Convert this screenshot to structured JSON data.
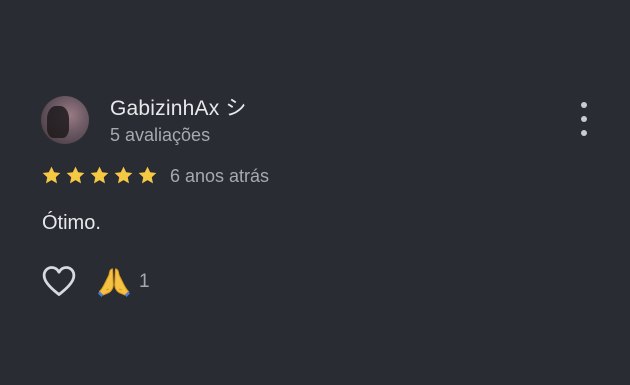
{
  "review": {
    "author_name": "GabizinhAx シ",
    "author_reviews": "5 avaliações",
    "rating": 5,
    "rating_max": 5,
    "date": "6 anos atrás",
    "text": "Ótimo.",
    "reaction_emoji": "folded-hands",
    "reaction_count": "1",
    "more_icon": "more-vert-icon",
    "like_icon": "heart-outline-icon"
  },
  "colors": {
    "background": "#2a2c33",
    "primary_text": "#e7e8ec",
    "secondary_text": "#a6a9b1",
    "star": "#f6c945"
  }
}
